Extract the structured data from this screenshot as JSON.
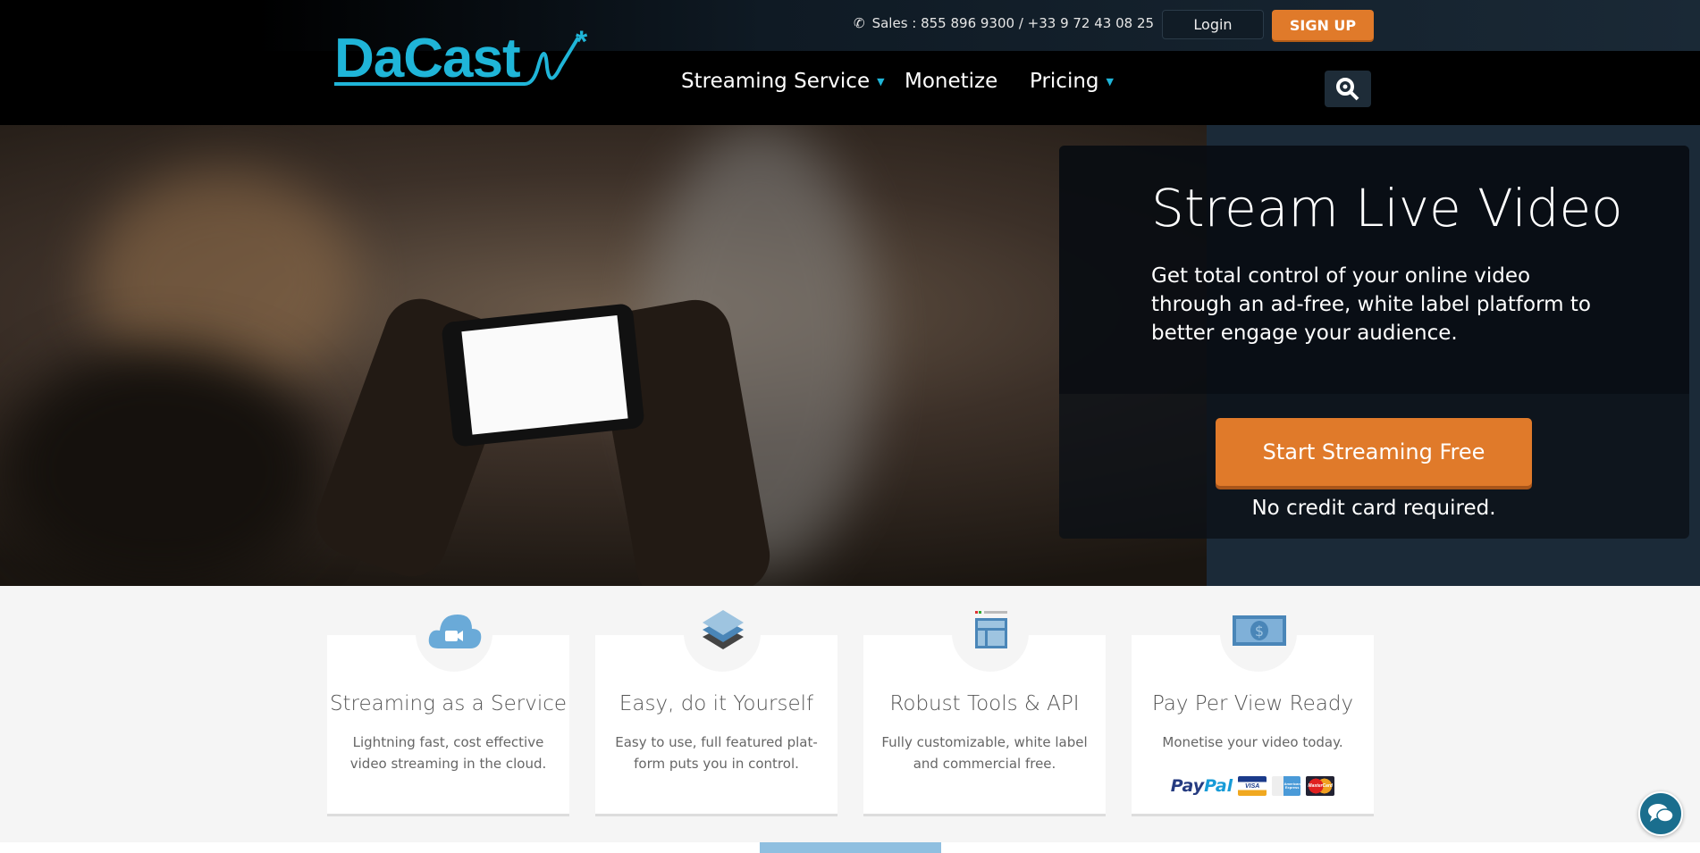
{
  "header": {
    "logo": "DaCast",
    "sales": "Sales : 855 896 9300 / +33 9 72 43 08 25",
    "login": "Login",
    "signup": "SIGN UP",
    "nav": [
      {
        "label": "Streaming Service",
        "dropdown": true
      },
      {
        "label": "Monetize",
        "dropdown": false
      },
      {
        "label": "Pricing",
        "dropdown": true
      }
    ]
  },
  "hero": {
    "title": "Stream Live Video",
    "subtitle": "Get total control of your online video through an ad-free, white label platform to better engage your audience.",
    "cta": "Start Streaming Free",
    "note": "No credit card required."
  },
  "features": [
    {
      "icon": "cloud-video-icon",
      "title": "Streaming as a Service",
      "desc": "Lightning fast, cost effective video streaming in the cloud."
    },
    {
      "icon": "layers-icon",
      "title": "Easy, do it Yourself",
      "desc": "Easy to use, full featured plat-form puts you in control."
    },
    {
      "icon": "browser-layout-icon",
      "title": "Robust Tools & API",
      "desc": "Fully customizable, white label and commercial free."
    },
    {
      "icon": "banknote-icon",
      "title": "Pay Per View Ready",
      "desc": "Monetise your video today.",
      "payments": [
        "PayPal",
        "Visa",
        "American Express",
        "MasterCard"
      ]
    }
  ],
  "colors": {
    "brand": "#1fb5d8",
    "accent": "#e07a2a",
    "icon": "#6aaad8"
  }
}
